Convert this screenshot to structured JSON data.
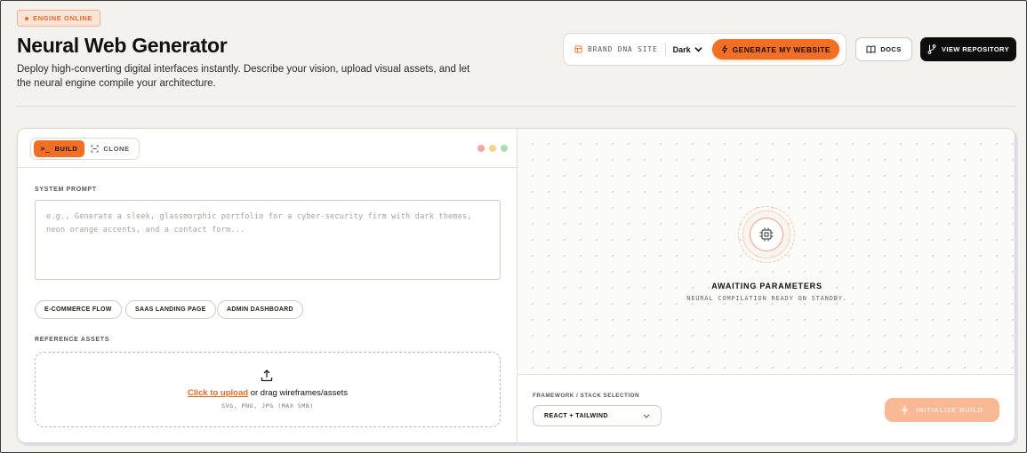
{
  "header": {
    "status_badge": "ENGINE ONLINE",
    "title": "Neural Web Generator",
    "description": "Deploy high-converting digital interfaces instantly. Describe your vision, upload visual assets, and let the neural engine compile your architecture."
  },
  "actions": {
    "brand_dna_label": "BRAND DNA SITE",
    "theme_value": "Dark",
    "generate_label": "GENERATE MY WEBSITE",
    "docs_label": "DOCS",
    "repo_label": "VIEW REPOSITORY"
  },
  "builder": {
    "tabs": [
      {
        "label": "BUILD",
        "active": true
      },
      {
        "label": "CLONE",
        "active": false
      }
    ],
    "system_prompt_label": "SYSTEM PROMPT",
    "system_prompt_placeholder": "e.g., Generate a sleek, glassmorphic portfolio for a cyber-security firm with dark themes, neon orange accents, and a contact form...",
    "templates": [
      "E-COMMERCE FLOW",
      "SAAS LANDING PAGE",
      "ADMIN DASHBOARD"
    ],
    "reference_assets_label": "REFERENCE ASSETS",
    "upload_link": "Click to upload",
    "upload_text": " or drag wireframes/assets",
    "upload_hint": "SVG, PNG, JPG (MAX 5MB)"
  },
  "preview": {
    "status_title": "AWAITING PARAMETERS",
    "status_subtitle": "NEURAL COMPILATION READY ON STANDBY.",
    "stack_label": "FRAMEWORK / STACK SELECTION",
    "stack_value": "REACT + TAILWIND",
    "init_label": "INITIALIZE BUILD"
  },
  "colors": {
    "accent": "#f26f24",
    "background": "#f4f2ee",
    "window_dots": [
      "#f3a6a6",
      "#f3d68a",
      "#a9e0b0"
    ]
  }
}
